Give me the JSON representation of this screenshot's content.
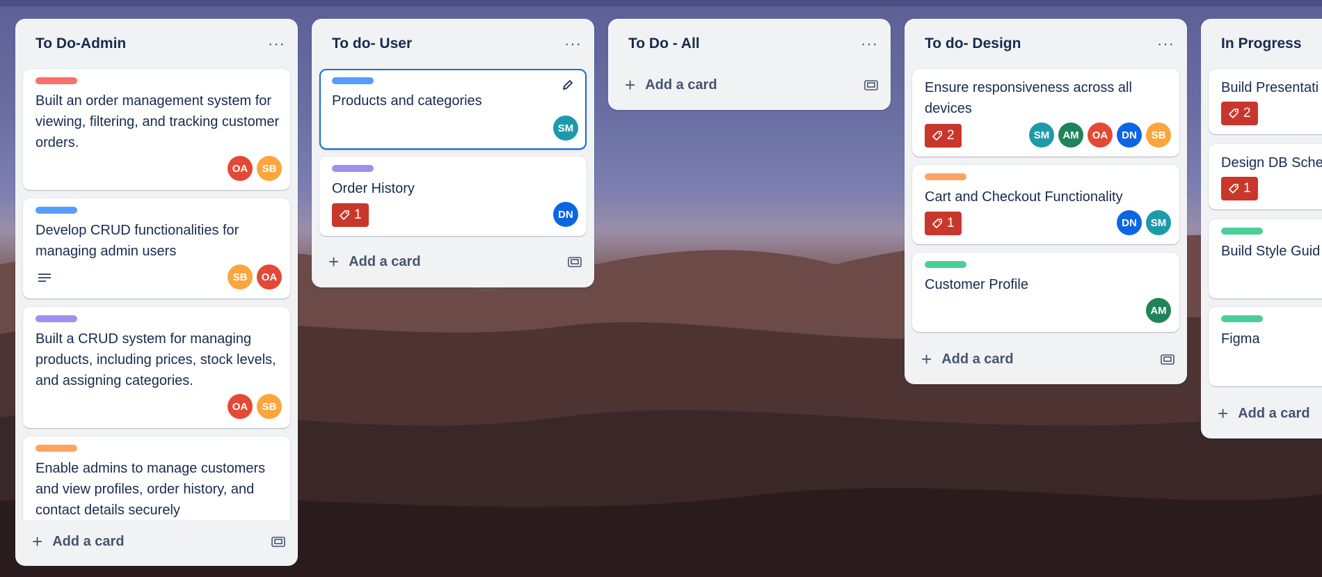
{
  "colors": {
    "red": "#f87168",
    "blue": "#579dff",
    "purple": "#9f8fef",
    "orange": "#fea362",
    "green": "#4bce97",
    "avatar_OA": "#e34935",
    "avatar_SB": "#faa53d",
    "avatar_SM": "#1d9aaa",
    "avatar_AM": "#1f845a",
    "avatar_DN": "#0c66e4"
  },
  "common": {
    "add_card": "Add a card",
    "more": "···"
  },
  "lists": [
    {
      "title": "To Do-Admin",
      "cards": [
        {
          "label": "red",
          "text": "Built an order management system for viewing, filtering, and tracking customer orders.",
          "members": [
            "OA",
            "SB"
          ]
        },
        {
          "label": "blue",
          "text": "Develop CRUD functionalities for managing admin users",
          "description_icon": "description-icon",
          "members": [
            "SB",
            "OA"
          ]
        },
        {
          "label": "purple",
          "text": "Built a CRUD system for managing products, including prices, stock levels, and assigning categories.",
          "members": [
            "OA",
            "SB"
          ]
        },
        {
          "label": "orange",
          "text": "Enable admins to manage customers and view profiles, order history, and contact details securely"
        }
      ]
    },
    {
      "title": "To do- User",
      "cards": [
        {
          "label": "blue",
          "text": "Products and categories",
          "members": [
            "SM"
          ],
          "selected": true
        },
        {
          "label": "purple",
          "text": "Order History",
          "badge": "1",
          "members": [
            "DN"
          ]
        }
      ]
    },
    {
      "title": "To Do - All",
      "cards": []
    },
    {
      "title": "To do- Design",
      "cards": [
        {
          "text": "Ensure responsiveness across all devices",
          "badge": "2",
          "members": [
            "SM",
            "AM",
            "OA",
            "DN",
            "SB"
          ]
        },
        {
          "label": "orange",
          "text": "Cart and Checkout Functionality",
          "badge": "1",
          "members": [
            "DN",
            "SM"
          ]
        },
        {
          "label": "green",
          "text": "Customer Profile",
          "members": [
            "AM"
          ]
        }
      ]
    },
    {
      "title": "In Progress",
      "cards": [
        {
          "text": "Build Presentati",
          "badge": "2"
        },
        {
          "text": "Design DB Sche",
          "badge": "1"
        },
        {
          "label": "green",
          "text": "Build Style Guid"
        },
        {
          "label": "green",
          "text": "Figma"
        }
      ]
    }
  ]
}
